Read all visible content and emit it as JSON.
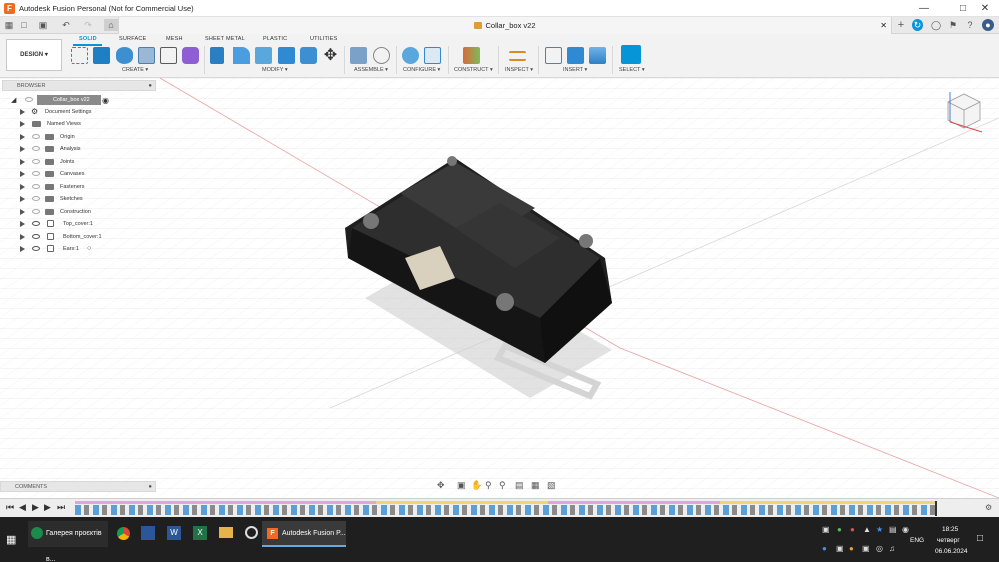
{
  "window": {
    "title": "Autodesk Fusion Personal (Not for Commercial Use)",
    "controls": [
      "minimize-icon",
      "maximize-icon",
      "close-icon"
    ]
  },
  "document_tab": {
    "title": "Collar_box v22"
  },
  "toolbar": {
    "workspace": "DESIGN",
    "tabs": [
      "SOLID",
      "SURFACE",
      "MESH",
      "SHEET METAL",
      "PLASTIC",
      "UTILITIES"
    ],
    "active_tab": "SOLID",
    "groups": [
      "CREATE",
      "MODIFY",
      "ASSEMBLE",
      "CONFIGURE",
      "CONSTRUCT",
      "INSPECT",
      "INSERT",
      "SELECT"
    ]
  },
  "browser": {
    "header": "BROWSER",
    "root": "Collar_box v22",
    "items": [
      "Document Settings",
      "Named Views",
      "Origin",
      "Analysis",
      "Joints",
      "Canvases",
      "Fasteners",
      "Sketches",
      "Construction",
      "Top_cover:1",
      "Bottom_cover:1",
      "Ears:1"
    ]
  },
  "comments": {
    "label": "COMMENTS"
  },
  "taskbar": {
    "apps": [
      "Галерея проєктів в...",
      "Autodesk Fusion P..."
    ],
    "language": "ENG",
    "time": "18:25",
    "day": "четверг",
    "date": "06.06.2024"
  },
  "colors": {
    "accent": "#0696d7",
    "taskbar": "#1f1f1f",
    "model": "#2a2a2a",
    "label_patch": "#d9d1bd"
  }
}
